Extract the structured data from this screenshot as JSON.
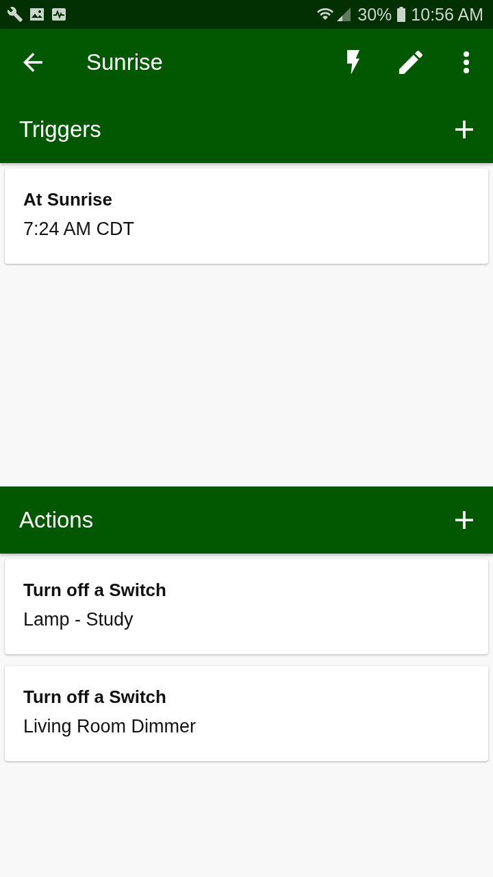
{
  "status_bar": {
    "battery": "30%",
    "time": "10:56 AM"
  },
  "app_bar": {
    "title": "Sunrise"
  },
  "sections": [
    {
      "title": "Triggers",
      "items": [
        {
          "title": "At Sunrise",
          "subtitle": "7:24 AM CDT"
        }
      ]
    },
    {
      "title": "Actions",
      "items": [
        {
          "title": "Turn off a Switch",
          "subtitle": "Lamp - Study"
        },
        {
          "title": "Turn off a Switch",
          "subtitle": "Living Room Dimmer"
        }
      ]
    }
  ]
}
